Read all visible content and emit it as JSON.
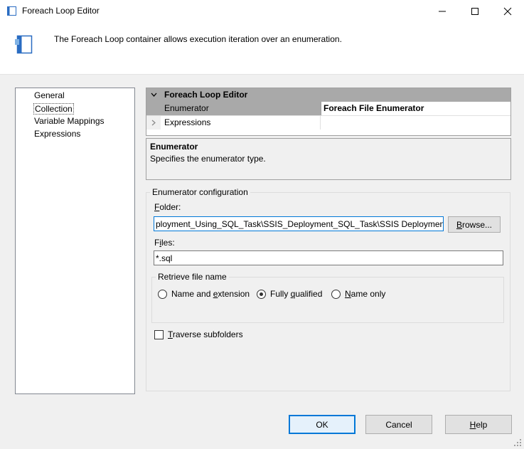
{
  "window": {
    "title": "Foreach Loop Editor"
  },
  "header": {
    "description": "The Foreach Loop container allows execution iteration over an enumeration."
  },
  "nav": {
    "items": [
      "General",
      "Collection",
      "Variable Mappings",
      "Expressions"
    ],
    "selected": "Collection"
  },
  "grid": {
    "category": "Foreach Loop Editor",
    "rows": [
      {
        "name": "Enumerator",
        "value": "Foreach File Enumerator"
      },
      {
        "name": "Expressions",
        "value": ""
      }
    ]
  },
  "description_panel": {
    "title": "Enumerator",
    "text": "Specifies the enumerator type."
  },
  "config": {
    "group_label": "Enumerator configuration",
    "folder": {
      "label_u": "F",
      "label_rest": "older:",
      "value": "ployment_Using_SQL_Task\\SSIS_Deployment_SQL_Task\\SSIS Deployment Tip",
      "browse_u": "B",
      "browse_rest": "rowse..."
    },
    "files": {
      "label_a": "F",
      "label_u": "i",
      "label_rest": "les:",
      "value": "*.sql"
    },
    "retrieve": {
      "label": "Retrieve file name",
      "options": [
        {
          "a": "Name and ",
          "u": "e",
          "b": "xtension",
          "checked": false
        },
        {
          "a": "Fully ",
          "u": "q",
          "b": "ualified",
          "checked": true
        },
        {
          "a": "",
          "u": "N",
          "b": "ame only",
          "checked": false
        }
      ]
    },
    "traverse": {
      "u": "T",
      "rest": "raverse subfolders",
      "checked": false
    }
  },
  "buttons": {
    "ok": "OK",
    "cancel": "Cancel",
    "help_u": "H",
    "help_rest": "elp"
  }
}
